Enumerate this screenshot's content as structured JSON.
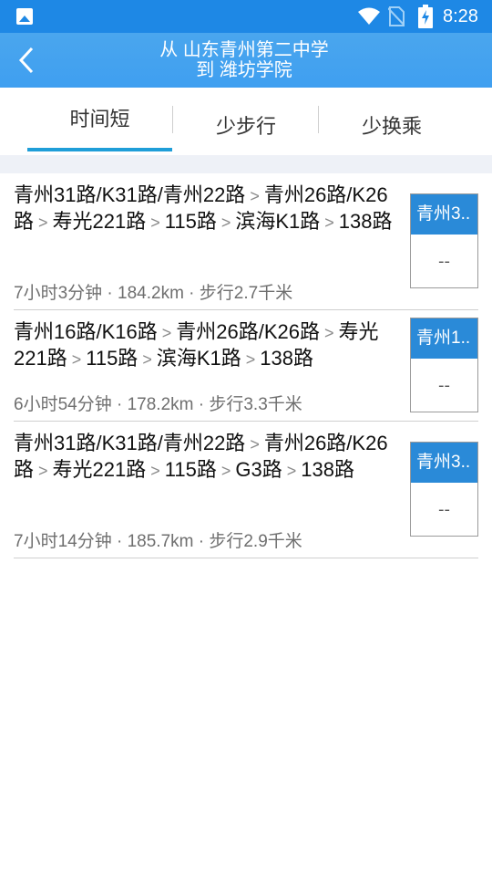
{
  "status_bar": {
    "time": "8:28",
    "icons": [
      "image-icon",
      "wifi-icon",
      "no-sim-icon",
      "battery-charging-icon"
    ]
  },
  "header": {
    "line1": "从 山东青州第二中学",
    "line2": "到 潍坊学院",
    "back_icon": "back-chevron-icon"
  },
  "tabs": [
    {
      "label": "时间短",
      "selected": true
    },
    {
      "label": "少步行",
      "selected": false
    },
    {
      "label": "少换乘",
      "selected": false
    }
  ],
  "routes": [
    {
      "segments": [
        "青州31路/K31路/青州22路",
        "青州26路/K26路",
        "寿光221路",
        "115路",
        "滨海K1路",
        "138路"
      ],
      "meta": "7小时3分钟 · 184.2km · 步行2.7千米",
      "badge_top": "青州3..",
      "badge_bottom": "--"
    },
    {
      "segments": [
        "青州16路/K16路",
        "青州26路/K26路",
        "寿光221路",
        "115路",
        "滨海K1路",
        "138路"
      ],
      "meta": "6小时54分钟 · 178.2km · 步行3.3千米",
      "badge_top": "青州1..",
      "badge_bottom": "--"
    },
    {
      "segments": [
        "青州31路/K31路/青州22路",
        "青州26路/K26路",
        "寿光221路",
        "115路",
        "G3路",
        "138路"
      ],
      "meta": "7小时14分钟 · 185.7km · 步行2.9千米",
      "badge_top": "青州3..",
      "badge_bottom": "--"
    }
  ],
  "colors": {
    "status_bar": "#1e88e5",
    "header": "#42a2f0",
    "tab_underline": "#1f9ed8",
    "badge": "#2a8ad8",
    "band": "#eef1f7"
  }
}
